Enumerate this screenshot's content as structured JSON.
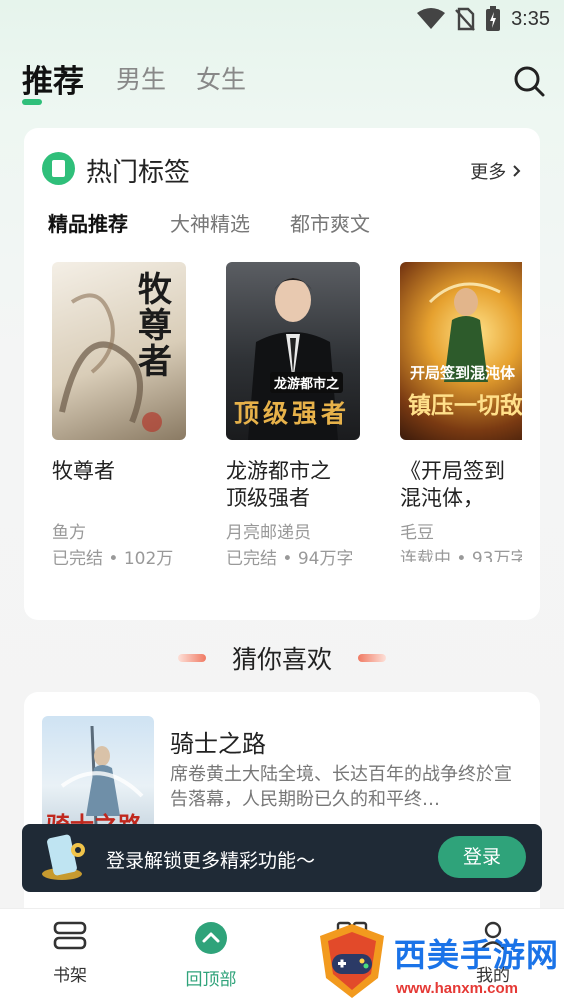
{
  "status_bar": {
    "time": "3:35"
  },
  "top_nav": {
    "tabs": [
      {
        "label": "推荐",
        "active": true
      },
      {
        "label": "男生",
        "active": false
      },
      {
        "label": "女生",
        "active": false
      }
    ]
  },
  "hot_section": {
    "title": "热门标签",
    "more": "更多",
    "sub_tabs": [
      "精品推荐",
      "大神精选",
      "都市爽文"
    ],
    "books": [
      {
        "title": "牧尊者",
        "cover_text": "牧尊者",
        "author": "鱼方",
        "meta": "已完结 • 102万"
      },
      {
        "title": "龙游都市之顶级强者",
        "cover_text": "顶级强者",
        "cover_sub": "龙游都市之",
        "author": "月亮邮递员",
        "meta": "已完结 • 94万字"
      },
      {
        "title": "《开局签到混沌体，镇…",
        "cover_text": "镇压一切敌",
        "cover_sub": "开局签到混沌体",
        "author": "毛豆",
        "meta": "连载中 • 93万字"
      }
    ]
  },
  "guess": {
    "title": "猜你喜欢",
    "book": {
      "title": "骑士之路",
      "cover_text": "骑士之路",
      "desc": "席卷黄土大陆全境、长达百年的战争终於宣告落幕，人民期盼已久的和平终…"
    }
  },
  "login_banner": {
    "text": "登录解锁更多精彩功能～",
    "button": "登录"
  },
  "bottom_nav": {
    "items": [
      {
        "label": "书架",
        "icon": "bookshelf-icon"
      },
      {
        "label": "回顶部",
        "icon": "back-to-top-icon"
      },
      {
        "label": "",
        "icon": "grid-icon"
      },
      {
        "label": "我的",
        "icon": "profile-icon"
      }
    ]
  },
  "watermark": {
    "text": "西美手游网",
    "url": "www.hanxm.com"
  },
  "colors": {
    "accent": "#2fbf7a",
    "banner_bg": "#1f2a36",
    "login_button": "#2fa37a"
  }
}
